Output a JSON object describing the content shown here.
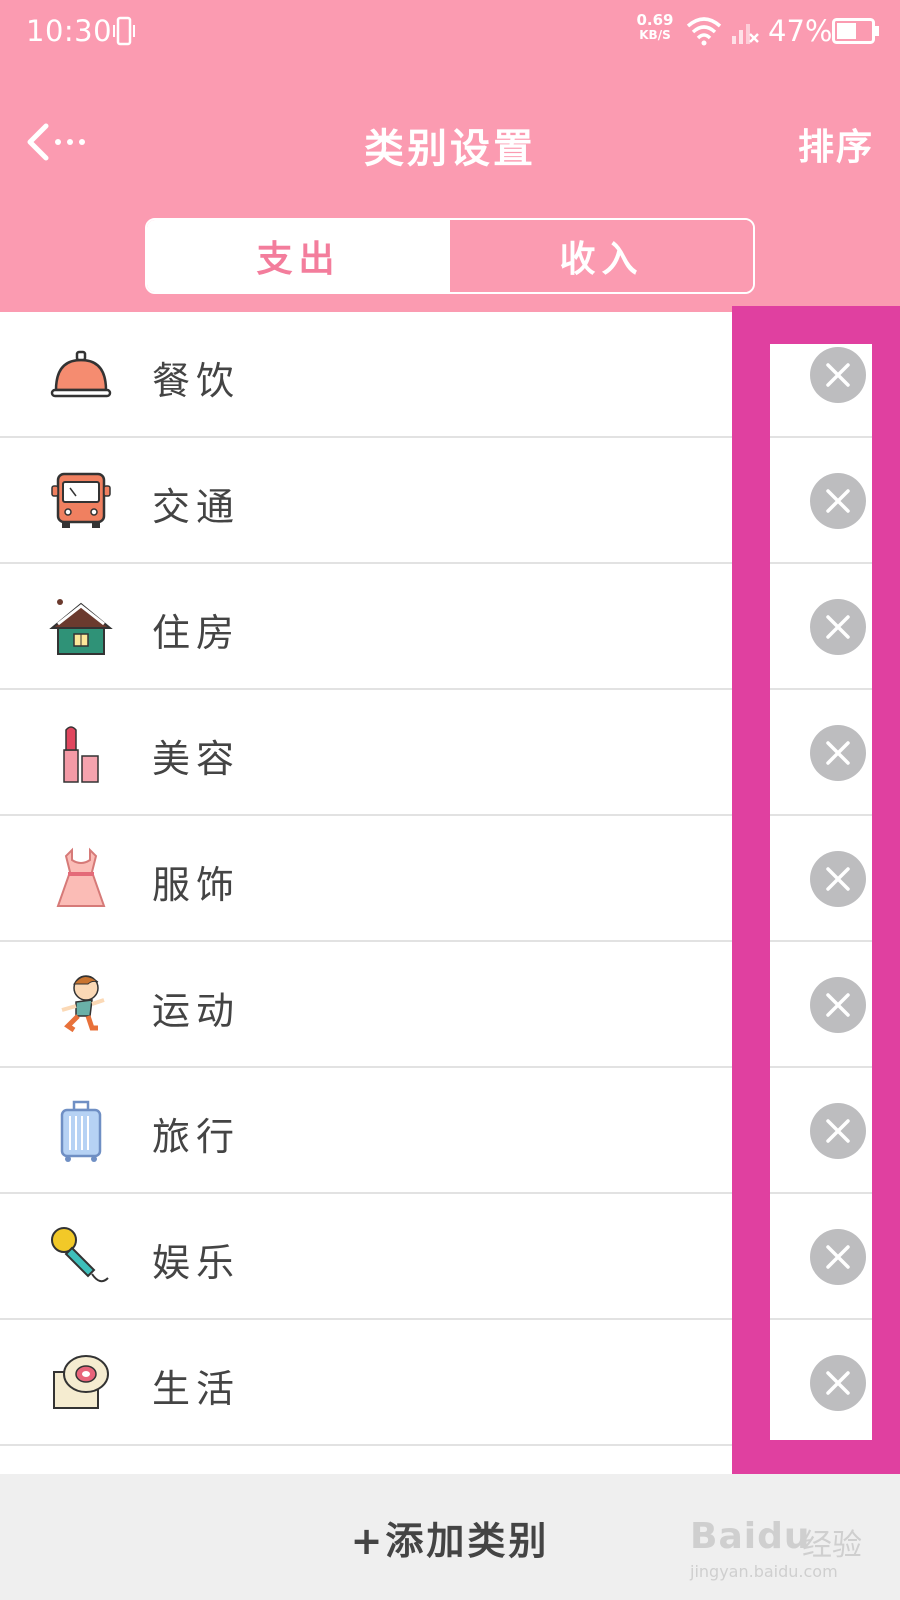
{
  "status_bar": {
    "time": "10:30",
    "net_speed_value": "0.69",
    "net_speed_unit": "KB/S",
    "battery": "47%"
  },
  "header": {
    "title": "类别设置",
    "sort_label": "排序"
  },
  "tabs": [
    {
      "label": "支出",
      "active": true
    },
    {
      "label": "收入",
      "active": false
    }
  ],
  "categories": [
    {
      "label": "餐饮",
      "icon": "cloche-icon"
    },
    {
      "label": "交通",
      "icon": "bus-icon"
    },
    {
      "label": "住房",
      "icon": "house-icon"
    },
    {
      "label": "美容",
      "icon": "lipstick-icon"
    },
    {
      "label": "服饰",
      "icon": "dress-icon"
    },
    {
      "label": "运动",
      "icon": "running-boy-icon"
    },
    {
      "label": "旅行",
      "icon": "suitcase-icon"
    },
    {
      "label": "娱乐",
      "icon": "microphone-icon"
    },
    {
      "label": "生活",
      "icon": "toilet-paper-icon"
    }
  ],
  "footer": {
    "add_label": "+添加类别"
  },
  "watermark": {
    "brand": "Baidu",
    "cn": "经验",
    "url": "jingyan.baidu.com"
  },
  "colors": {
    "header_bg": "#fb9bb1",
    "active_tab_text": "#f37d9c",
    "highlight_box": "#e040a0",
    "delete_button": "#bdbdbf"
  }
}
